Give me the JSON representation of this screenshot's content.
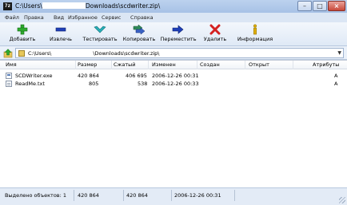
{
  "window": {
    "app_icon_text": "7z",
    "title_prefix": "C:\\Users\\",
    "title_suffix": "Downloads\\scdwriter.zip\\",
    "controls": {
      "minimize": "–",
      "maximize": "□",
      "close": "×"
    }
  },
  "menu": {
    "items": [
      "Файл",
      "Правка",
      "Вид",
      "Избранное",
      "Сервис",
      "Справка"
    ]
  },
  "toolbar": {
    "buttons": [
      {
        "label": "Добавить",
        "icon": "plus-icon",
        "color": "#2eaa2e"
      },
      {
        "label": "Извлечь",
        "icon": "minus-icon",
        "color": "#1f3fb8"
      },
      {
        "label": "Тестировать",
        "icon": "check-icon",
        "color": "#27b0b8"
      },
      {
        "label": "Копировать",
        "icon": "double-arrow-icon",
        "color": "#2f8a5a"
      },
      {
        "label": "Переместить",
        "icon": "arrow-right-icon",
        "color": "#1f3fb8"
      },
      {
        "label": "Удалить",
        "icon": "delete-x-icon",
        "color": "#d42020"
      },
      {
        "label": "Информация",
        "icon": "info-icon",
        "color": "#e0b000"
      }
    ]
  },
  "address": {
    "prefix": "C:\\Users\\",
    "suffix": "\\Downloads\\scdwriter.zip\\"
  },
  "list": {
    "columns": [
      "Имя",
      "Размер",
      "Сжатый",
      "Изменен",
      "Создан",
      "Открыт",
      "Атрибуты"
    ],
    "rows": [
      {
        "name": "SCDWriter.exe",
        "size": "420 864",
        "packed": "406 695",
        "modified": "2006-12-26 00:31",
        "created": "",
        "accessed": "",
        "attributes": "A",
        "icon": "exe-file-icon"
      },
      {
        "name": "ReadMe.txt",
        "size": "805",
        "packed": "538",
        "modified": "2006-12-26 00:33",
        "created": "",
        "accessed": "",
        "attributes": "A",
        "icon": "txt-file-icon"
      }
    ]
  },
  "status": {
    "selected": "Выделено объектов: 1",
    "size": "420 864",
    "packed": "420 864",
    "modified": "2006-12-26 00:31"
  }
}
